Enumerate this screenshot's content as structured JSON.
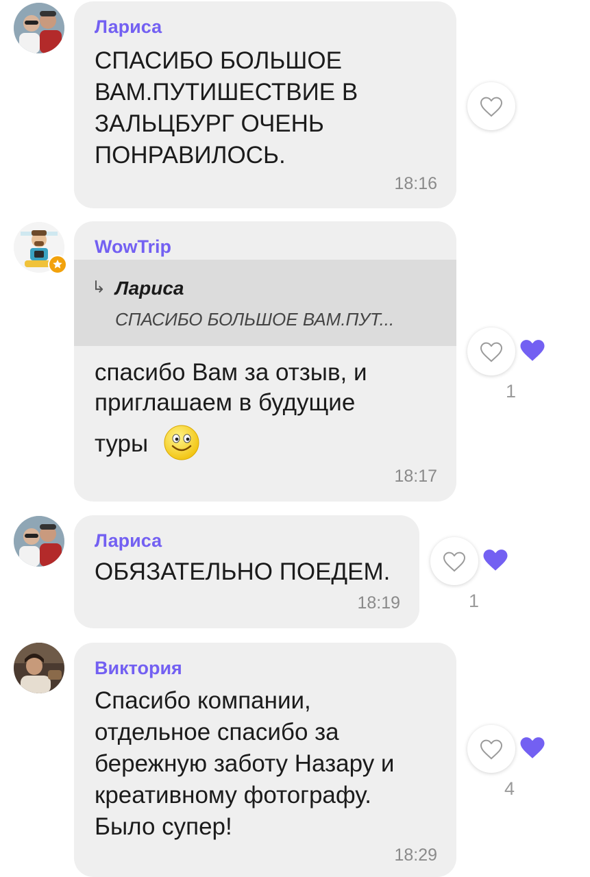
{
  "colors": {
    "accent": "#7360f2",
    "bubble": "#efefef",
    "quote_bg": "#dcdcdc"
  },
  "messages": [
    {
      "sender": "Лариса",
      "text": "СПАСИБО БОЛЬШОЕ\nВАМ.ПУТИШЕСТВИЕ В\nЗАЛЬЦБУРГ ОЧЕНЬ\nПОНРАВИЛОСЬ.",
      "time": "18:16"
    },
    {
      "sender": "WowTrip",
      "quote_author": "Лариса",
      "quote_text": "СПАСИБО БОЛЬШОЕ ВАМ.ПУТ...",
      "text_line1": "спасибо Вам за отзыв, и",
      "text_line2": "приглашаем в будущие",
      "text_line3": "туры",
      "emoji": "smiley-face-emoji",
      "time": "18:17",
      "likes": "1"
    },
    {
      "sender": "Лариса",
      "text": "ОБЯЗАТЕЛЬНО ПОЕДЕМ.",
      "time": "18:19",
      "likes": "1"
    },
    {
      "sender": "Виктория",
      "text": "Спасибо компании,\nотдельное спасибо за\nбережную заботу Назару и\nкреативному  фотографу.\nБыло супер!",
      "time": "18:29",
      "likes": "4"
    }
  ]
}
